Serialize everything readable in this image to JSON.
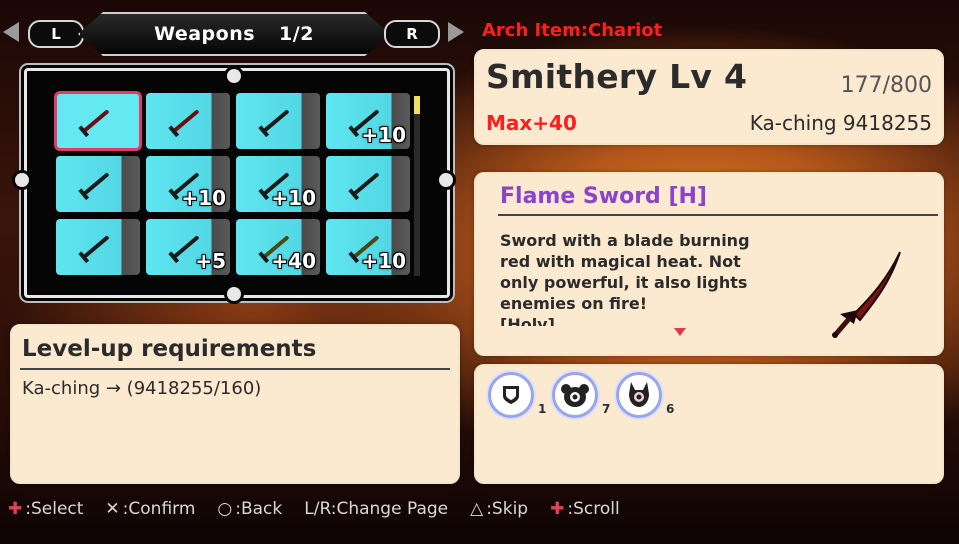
{
  "weapons_tab": {
    "title": "Weapons",
    "page": "1/2",
    "left_button": "L",
    "right_button": "R"
  },
  "weapon_grid": [
    {
      "plus": "",
      "color": "red"
    },
    {
      "plus": "",
      "color": "red"
    },
    {
      "plus": "",
      "color": "dark"
    },
    {
      "plus": "+10",
      "color": "dark"
    },
    {
      "plus": "",
      "color": "dark"
    },
    {
      "plus": "+10",
      "color": "dark"
    },
    {
      "plus": "+10",
      "color": "dark"
    },
    {
      "plus": "",
      "color": "dark"
    },
    {
      "plus": "",
      "color": "dark"
    },
    {
      "plus": "+5",
      "color": "dark"
    },
    {
      "plus": "+40",
      "color": "gold"
    },
    {
      "plus": "+10",
      "color": "gold"
    }
  ],
  "arch_item": "Arch Item:Chariot",
  "smithery": {
    "title": "Smithery Lv 4",
    "progress": "177/800",
    "max": "Max+40",
    "kaching": "Ka-ching 9418255"
  },
  "item": {
    "name": "Flame Sword [H]",
    "description": "Sword with a blade burning red with magical heat. Not only powerful, it also lights enemies on fire!",
    "description_cutoff": "[Holy]"
  },
  "requirements": {
    "title": "Level-up requirements",
    "line": "Ka-ching → (9418255/160)"
  },
  "materials": [
    {
      "icon": "shield-icon",
      "count": "1"
    },
    {
      "icon": "ram-mask-icon",
      "count": "7"
    },
    {
      "icon": "horned-mask-icon",
      "count": "6"
    }
  ],
  "help": [
    {
      "glyph": "✚",
      "label": ":Select",
      "red": true
    },
    {
      "glyph": "✕",
      "label": ":Confirm",
      "red": false
    },
    {
      "glyph": "○",
      "label": ":Back",
      "red": false
    },
    {
      "glyph": "",
      "label": "L/R:Change Page",
      "red": false
    },
    {
      "glyph": "△",
      "label": ":Skip",
      "red": false
    },
    {
      "glyph": "✚",
      "label": ":Scroll",
      "red": true
    }
  ],
  "colors": {
    "slot_cyan": "#5fe6f0",
    "selected_outline": "#e23a6a",
    "accent_red": "#ff1e1e",
    "item_name_purple": "#8a44cc",
    "panel_cream": "#fbe9d0"
  }
}
